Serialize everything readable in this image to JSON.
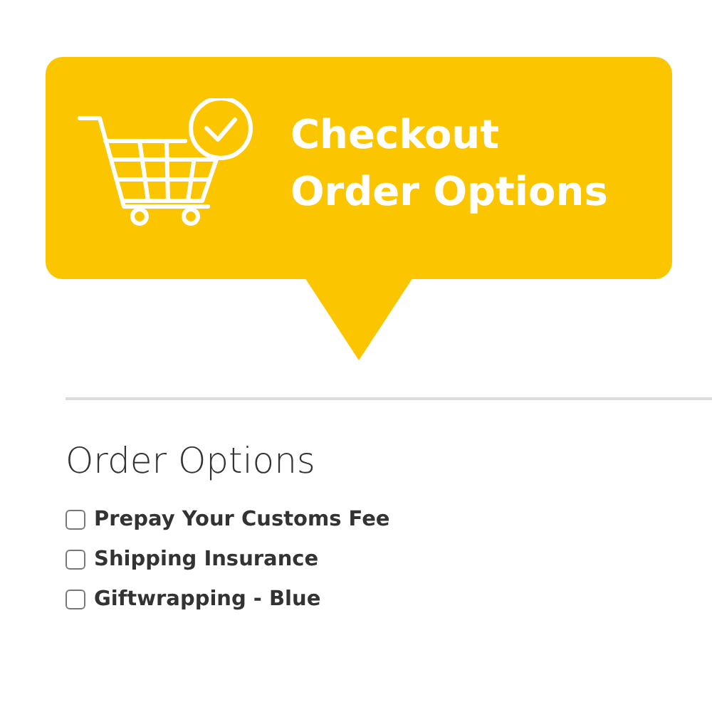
{
  "banner": {
    "title_lines": [
      "Checkout",
      "Order Options"
    ]
  },
  "section": {
    "heading": "Order Options"
  },
  "options": [
    {
      "label": "Prepay Your Customs Fee",
      "checked": false
    },
    {
      "label": "Shipping Insurance",
      "checked": false
    },
    {
      "label": "Giftwrapping - Blue",
      "checked": false
    }
  ]
}
